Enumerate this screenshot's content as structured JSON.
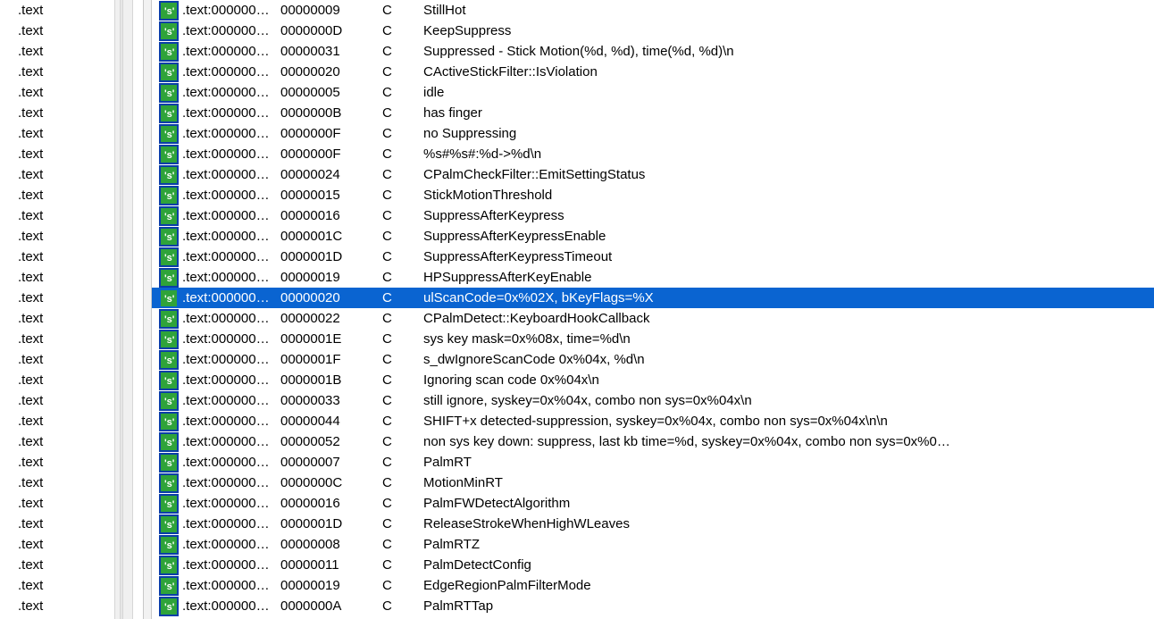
{
  "left_label": ".text",
  "left_row_count": 30,
  "selected_index": 14,
  "rows": [
    {
      "addr": ".text:000000…",
      "len": "00000009",
      "type": "C",
      "str": "StillHot"
    },
    {
      "addr": ".text:000000…",
      "len": "0000000D",
      "type": "C",
      "str": "KeepSuppress"
    },
    {
      "addr": ".text:000000…",
      "len": "00000031",
      "type": "C",
      "str": "Suppressed - Stick Motion(%d, %d), time(%d, %d)\\n"
    },
    {
      "addr": ".text:000000…",
      "len": "00000020",
      "type": "C",
      "str": "CActiveStickFilter::IsViolation"
    },
    {
      "addr": ".text:000000…",
      "len": "00000005",
      "type": "C",
      "str": "idle"
    },
    {
      "addr": ".text:000000…",
      "len": "0000000B",
      "type": "C",
      "str": "has finger"
    },
    {
      "addr": ".text:000000…",
      "len": "0000000F",
      "type": "C",
      "str": "no Suppressing"
    },
    {
      "addr": ".text:000000…",
      "len": "0000000F",
      "type": "C",
      "str": "%s#%s#:%d->%d\\n"
    },
    {
      "addr": ".text:000000…",
      "len": "00000024",
      "type": "C",
      "str": "CPalmCheckFilter::EmitSettingStatus"
    },
    {
      "addr": ".text:000000…",
      "len": "00000015",
      "type": "C",
      "str": "StickMotionThreshold"
    },
    {
      "addr": ".text:000000…",
      "len": "00000016",
      "type": "C",
      "str": "SuppressAfterKeypress"
    },
    {
      "addr": ".text:000000…",
      "len": "0000001C",
      "type": "C",
      "str": "SuppressAfterKeypressEnable"
    },
    {
      "addr": ".text:000000…",
      "len": "0000001D",
      "type": "C",
      "str": "SuppressAfterKeypressTimeout"
    },
    {
      "addr": ".text:000000…",
      "len": "00000019",
      "type": "C",
      "str": "HPSuppressAfterKeyEnable"
    },
    {
      "addr": ".text:000000…",
      "len": "00000020",
      "type": "C",
      "str": "ulScanCode=0x%02X, bKeyFlags=%X"
    },
    {
      "addr": ".text:000000…",
      "len": "00000022",
      "type": "C",
      "str": "CPalmDetect::KeyboardHookCallback"
    },
    {
      "addr": ".text:000000…",
      "len": "0000001E",
      "type": "C",
      "str": "sys key mask=0x%08x, time=%d\\n"
    },
    {
      "addr": ".text:000000…",
      "len": "0000001F",
      "type": "C",
      "str": "s_dwIgnoreScanCode 0x%04x, %d\\n"
    },
    {
      "addr": ".text:000000…",
      "len": "0000001B",
      "type": "C",
      "str": "Ignoring scan code 0x%04x\\n"
    },
    {
      "addr": ".text:000000…",
      "len": "00000033",
      "type": "C",
      "str": "still ignore, syskey=0x%04x, combo non sys=0x%04x\\n"
    },
    {
      "addr": ".text:000000…",
      "len": "00000044",
      "type": "C",
      "str": "SHIFT+x detected-suppression, syskey=0x%04x, combo non sys=0x%04x\\n\\n"
    },
    {
      "addr": ".text:000000…",
      "len": "00000052",
      "type": "C",
      "str": "non sys key down: suppress, last kb time=%d, syskey=0x%04x, combo non sys=0x%0…"
    },
    {
      "addr": ".text:000000…",
      "len": "00000007",
      "type": "C",
      "str": "PalmRT"
    },
    {
      "addr": ".text:000000…",
      "len": "0000000C",
      "type": "C",
      "str": "MotionMinRT"
    },
    {
      "addr": ".text:000000…",
      "len": "00000016",
      "type": "C",
      "str": "PalmFWDetectAlgorithm"
    },
    {
      "addr": ".text:000000…",
      "len": "0000001D",
      "type": "C",
      "str": "ReleaseStrokeWhenHighWLeaves"
    },
    {
      "addr": ".text:000000…",
      "len": "00000008",
      "type": "C",
      "str": "PalmRTZ"
    },
    {
      "addr": ".text:000000…",
      "len": "00000011",
      "type": "C",
      "str": "PalmDetectConfig"
    },
    {
      "addr": ".text:000000…",
      "len": "00000019",
      "type": "C",
      "str": "EdgeRegionPalmFilterMode"
    },
    {
      "addr": ".text:000000…",
      "len": "0000000A",
      "type": "C",
      "str": "PalmRTTap"
    }
  ]
}
